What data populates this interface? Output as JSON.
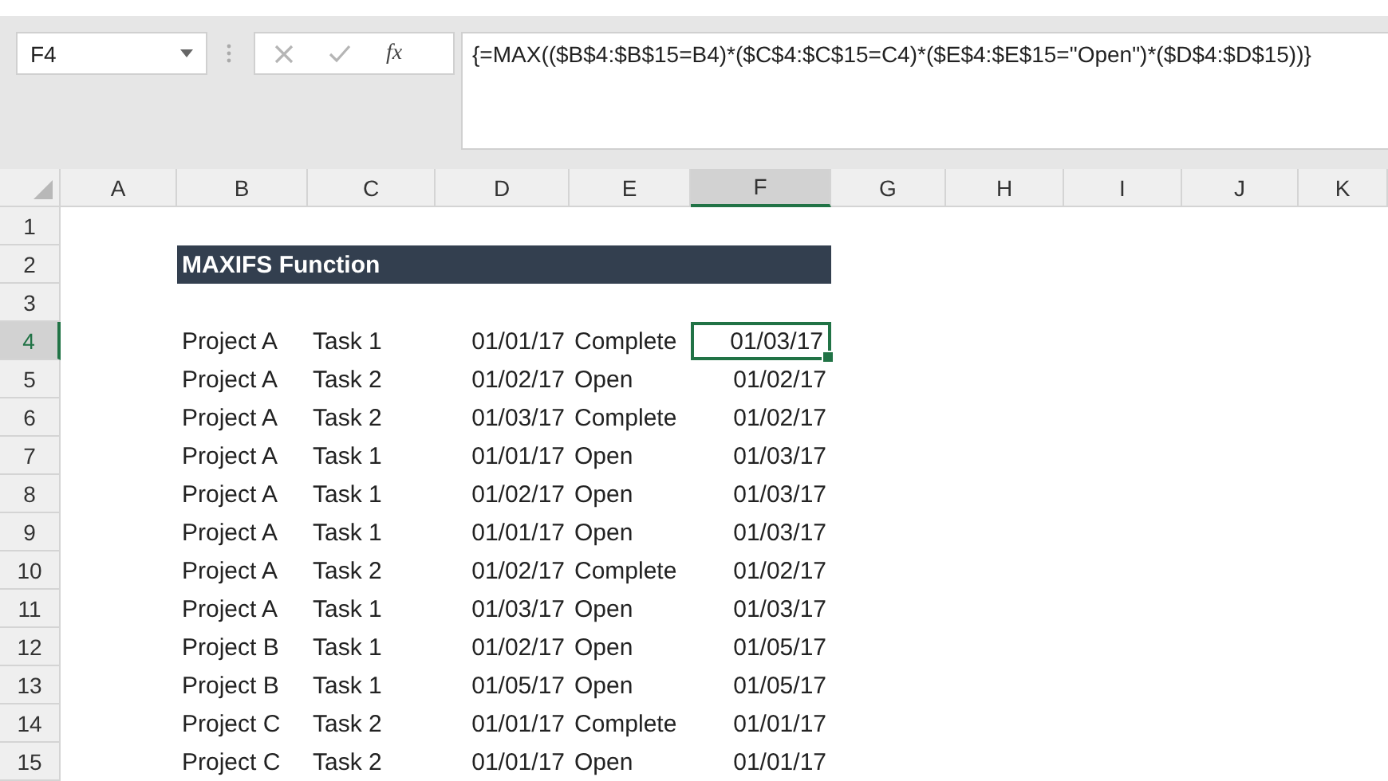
{
  "name_box": {
    "value": "F4"
  },
  "function_button": "fx",
  "formula_bar": {
    "value": "{=MAX(($B$4:$B$15=B4)*($C$4:$C$15=C4)*($E$4:$E$15=\"Open\")*($D$4:$D$15))}"
  },
  "columns": [
    {
      "label": "A",
      "selected": false
    },
    {
      "label": "B",
      "selected": false
    },
    {
      "label": "C",
      "selected": false
    },
    {
      "label": "D",
      "selected": false
    },
    {
      "label": "E",
      "selected": false
    },
    {
      "label": "F",
      "selected": true
    },
    {
      "label": "G",
      "selected": false
    },
    {
      "label": "H",
      "selected": false
    },
    {
      "label": "I",
      "selected": false
    },
    {
      "label": "J",
      "selected": false
    },
    {
      "label": "K",
      "selected": false
    }
  ],
  "title": "MAXIFS Function",
  "rows": [
    {
      "number": "1",
      "selected": false,
      "kind": "empty"
    },
    {
      "number": "2",
      "selected": false,
      "kind": "title"
    },
    {
      "number": "3",
      "selected": false,
      "kind": "empty"
    },
    {
      "number": "4",
      "selected": true,
      "kind": "data",
      "cells": [
        "Project A",
        "Task 1",
        "01/01/17",
        "Complete",
        "01/03/17"
      ]
    },
    {
      "number": "5",
      "selected": false,
      "kind": "data",
      "cells": [
        "Project A",
        "Task 2",
        "01/02/17",
        "Open",
        "01/02/17"
      ]
    },
    {
      "number": "6",
      "selected": false,
      "kind": "data",
      "cells": [
        "Project A",
        "Task 2",
        "01/03/17",
        "Complete",
        "01/02/17"
      ]
    },
    {
      "number": "7",
      "selected": false,
      "kind": "data",
      "cells": [
        "Project A",
        "Task 1",
        "01/01/17",
        "Open",
        "01/03/17"
      ]
    },
    {
      "number": "8",
      "selected": false,
      "kind": "data",
      "cells": [
        "Project A",
        "Task 1",
        "01/02/17",
        "Open",
        "01/03/17"
      ]
    },
    {
      "number": "9",
      "selected": false,
      "kind": "data",
      "cells": [
        "Project A",
        "Task 1",
        "01/01/17",
        "Open",
        "01/03/17"
      ]
    },
    {
      "number": "10",
      "selected": false,
      "kind": "data",
      "cells": [
        "Project A",
        "Task 2",
        "01/02/17",
        "Complete",
        "01/02/17"
      ]
    },
    {
      "number": "11",
      "selected": false,
      "kind": "data",
      "cells": [
        "Project A",
        "Task 1",
        "01/03/17",
        "Open",
        "01/03/17"
      ]
    },
    {
      "number": "12",
      "selected": false,
      "kind": "data",
      "cells": [
        "Project B",
        "Task 1",
        "01/02/17",
        "Open",
        "01/05/17"
      ]
    },
    {
      "number": "13",
      "selected": false,
      "kind": "data",
      "cells": [
        "Project B",
        "Task 1",
        "01/05/17",
        "Open",
        "01/05/17"
      ]
    },
    {
      "number": "14",
      "selected": false,
      "kind": "data",
      "cells": [
        "Project C",
        "Task 2",
        "01/01/17",
        "Complete",
        "01/01/17"
      ]
    },
    {
      "number": "15",
      "selected": false,
      "kind": "data",
      "cells": [
        "Project C",
        "Task 2",
        "01/01/17",
        "Open",
        "01/01/17"
      ]
    }
  ]
}
